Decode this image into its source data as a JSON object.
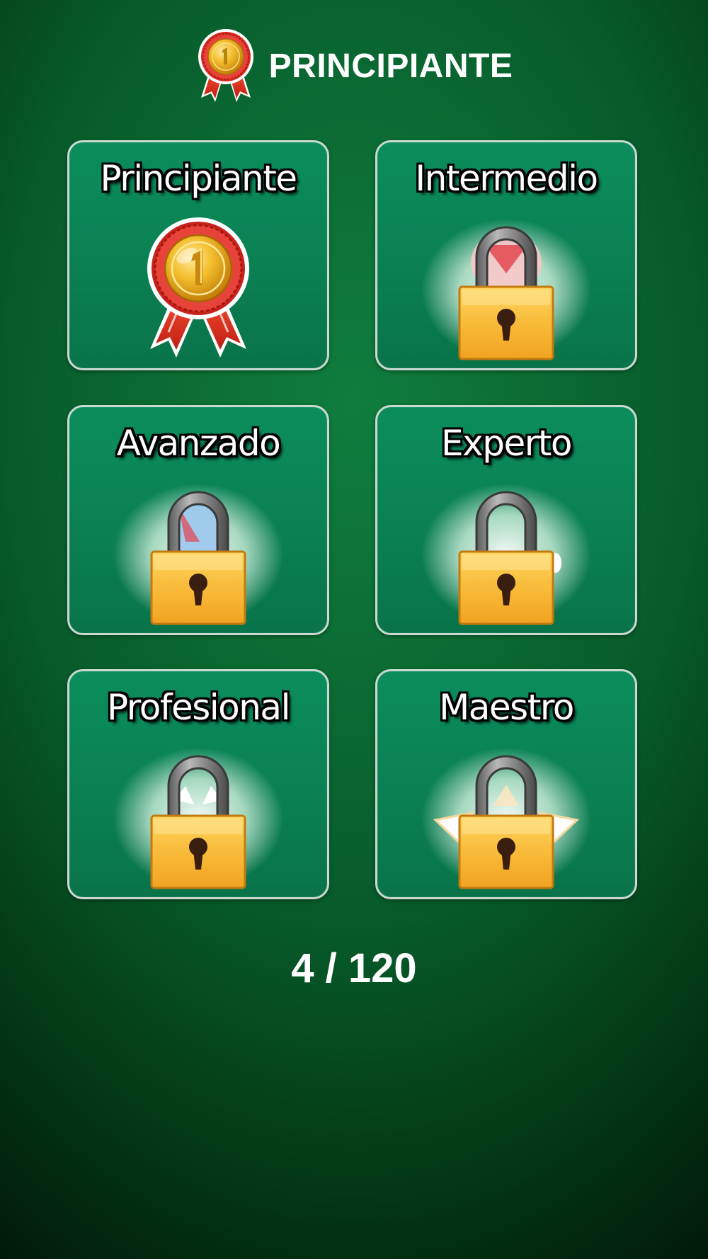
{
  "header": {
    "title": "PRINCIPIANTE",
    "icon": "medal-icon"
  },
  "levels": [
    {
      "label": "Principiante",
      "icon": "medal-icon",
      "locked": false
    },
    {
      "label": "Intermedio",
      "icon": "lock-icon",
      "locked": true
    },
    {
      "label": "Avanzado",
      "icon": "lock-icon",
      "locked": true
    },
    {
      "label": "Experto",
      "icon": "lock-icon",
      "locked": true
    },
    {
      "label": "Profesional",
      "icon": "lock-icon",
      "locked": true
    },
    {
      "label": "Maestro",
      "icon": "lock-icon",
      "locked": true
    }
  ],
  "progress": {
    "text": "4 / 120"
  },
  "colors": {
    "background": "#0b6a33",
    "tile": "#0a7f52",
    "tile_border": "#c9d9cf",
    "lock_body": "#f7b733",
    "medal_gold": "#f0b429",
    "ribbon_red": "#d62b1f"
  }
}
